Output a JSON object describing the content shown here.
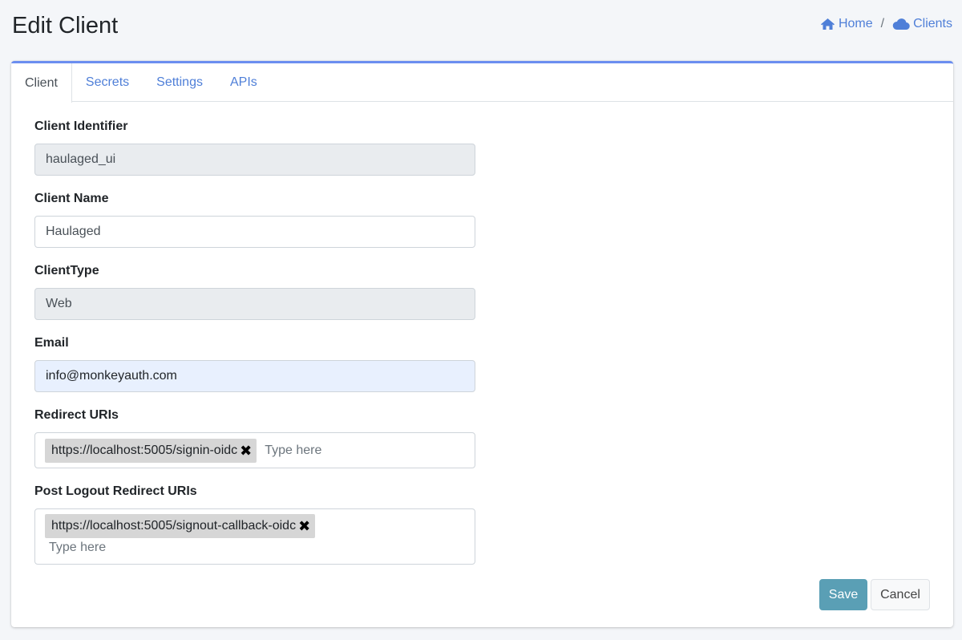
{
  "page": {
    "title": "Edit Client"
  },
  "breadcrumb": {
    "home": "Home",
    "separator": "/",
    "clients": "Clients"
  },
  "tabs": [
    {
      "label": "Client",
      "active": true
    },
    {
      "label": "Secrets",
      "active": false
    },
    {
      "label": "Settings",
      "active": false
    },
    {
      "label": "APIs",
      "active": false
    }
  ],
  "form": {
    "client_identifier": {
      "label": "Client Identifier",
      "value": "haulaged_ui"
    },
    "client_name": {
      "label": "Client Name",
      "value": "Haulaged"
    },
    "client_type": {
      "label": "ClientType",
      "value": "Web"
    },
    "email": {
      "label": "Email",
      "value": "info@monkeyauth.com"
    },
    "redirect_uris": {
      "label": "Redirect URIs",
      "tags": [
        "https://localhost:5005/signin-oidc"
      ],
      "placeholder": "Type here"
    },
    "post_logout_redirect_uris": {
      "label": "Post Logout Redirect URIs",
      "tags": [
        "https://localhost:5005/signout-callback-oidc"
      ],
      "placeholder": "Type here"
    }
  },
  "buttons": {
    "save": "Save",
    "cancel": "Cancel"
  },
  "colors": {
    "accent": "#4f7fd8",
    "card_top_border": "#6b8ef0",
    "save_button": "#5a9fb5"
  },
  "icons": {
    "home": "home-icon",
    "clients": "cloud-icon",
    "remove_tag": "close-icon"
  }
}
